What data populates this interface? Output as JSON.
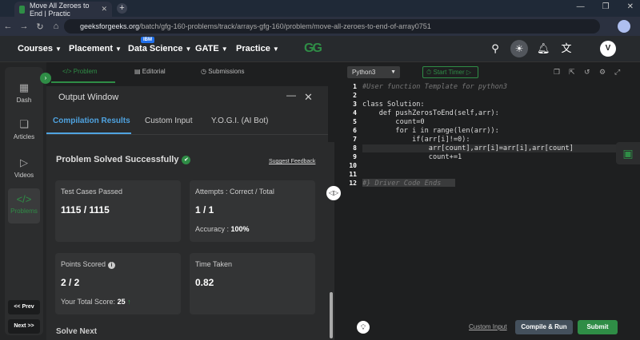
{
  "browser": {
    "tab_title": "Move All Zeroes to End | Practic",
    "url_host": "geeksforgeeks.org",
    "url_path": "/batch/gfg-160-problems/track/arrays-gfg-160/problem/move-all-zeroes-to-end-of-array0751"
  },
  "header": {
    "menus": [
      "Courses",
      "Placement",
      "Data Science",
      "GATE",
      "Practice"
    ],
    "ibm_badge": "IBM",
    "logo": "GG",
    "user_initial": "V"
  },
  "rail": {
    "items": [
      "Dash",
      "Articles",
      "Videos",
      "Problems"
    ],
    "prev_label": "<< Prev",
    "next_label": "Next >>"
  },
  "problem_tabs": [
    "Problem",
    "Editorial",
    "Submissions"
  ],
  "output": {
    "title": "Output Window",
    "tabs": [
      "Compilation Results",
      "Custom Input",
      "Y.O.G.I. (AI Bot)"
    ],
    "status": "Problem Solved Successfully",
    "feedback": "Suggest Feedback",
    "test_cases_label": "Test Cases Passed",
    "test_cases_value": "1115 / 1115",
    "attempts_label": "Attempts : Correct / Total",
    "attempts_value": "1 / 1",
    "accuracy_label": "Accuracy :",
    "accuracy_value": "100%",
    "points_label": "Points Scored",
    "points_value": "2 / 2",
    "total_score_label": "Your Total Score:",
    "total_score_value": "25",
    "time_label": "Time Taken",
    "time_value": "0.82",
    "solve_next": "Solve Next"
  },
  "editor": {
    "language": "Python3",
    "timer_label": "Start Timer",
    "custom_input": "Custom Input",
    "compile_label": "Compile & Run",
    "submit_label": "Submit",
    "lines": [
      "#User function Template for python3",
      "",
      "class Solution:",
      "    def pushZerosToEnd(self,arr):",
      "        count=0",
      "        for i in range(len(arr)):",
      "            if(arr[i]!=0):",
      "                arr[count],arr[i]=arr[i],arr[count]",
      "                count+=1",
      "",
      "",
      "#} Driver Code Ends"
    ],
    "line_numbers": [
      "1",
      "2",
      "3",
      "4",
      "5",
      "6",
      "7",
      "8",
      "9",
      "10",
      "11",
      "12"
    ]
  }
}
